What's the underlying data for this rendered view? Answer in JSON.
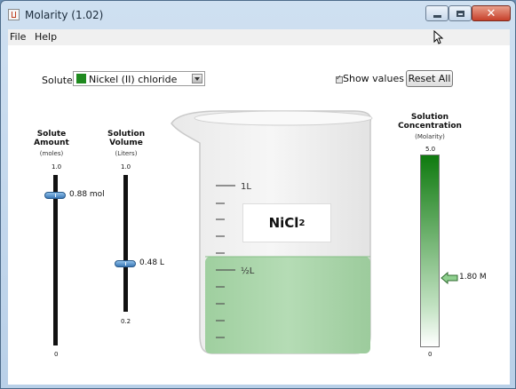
{
  "window": {
    "title": "Molarity (1.02)"
  },
  "menu": {
    "file": "File",
    "help": "Help"
  },
  "solute": {
    "label": "Solute:",
    "selected": "Nickel (II) chloride",
    "color": "#1f8a1f"
  },
  "controls": {
    "show_values_label": "Show values",
    "show_values_checked": true,
    "reset_label": "Reset All"
  },
  "solute_amount": {
    "title": "Solute\nAmount",
    "unit": "(moles)",
    "max": "1.0",
    "min": "0",
    "value_label": "0.88 mol",
    "value": 0.88
  },
  "solution_volume": {
    "title": "Solution\nVolume",
    "unit": "(Liters)",
    "max": "1.0",
    "min": "0.2",
    "value_label": "0.48 L",
    "value": 0.48
  },
  "beaker": {
    "formula": "NiCl",
    "subscript": "2",
    "mark_1l": "1L",
    "mark_half": "½L",
    "fill_fraction": 0.48,
    "solution_color": "#a9d6a9"
  },
  "concentration": {
    "title": "Solution\nConcentration",
    "unit": "(Molarity)",
    "max": "5.0",
    "min": "0",
    "value_label": "1.80 M",
    "value": 1.8
  }
}
